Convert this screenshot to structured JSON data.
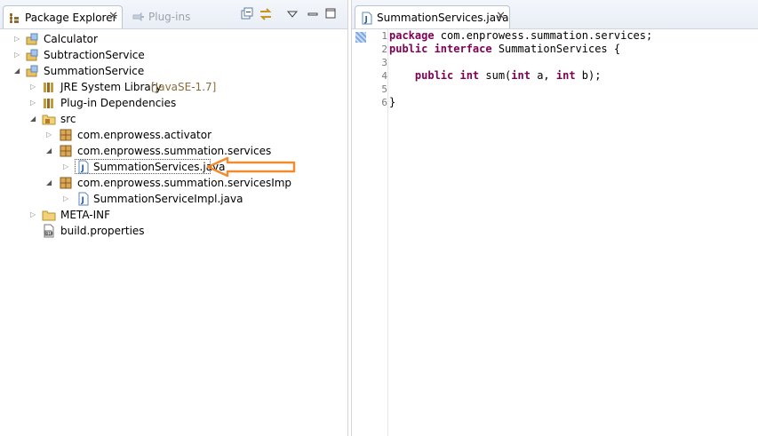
{
  "left_panel": {
    "tabs": [
      {
        "label": "Package Explorer",
        "active": true
      },
      {
        "label": "Plug-ins",
        "active": false
      }
    ],
    "toolbar_icons": [
      "collapse-all-icon",
      "link-with-editor-icon",
      "view-menu-icon",
      "minimize-icon",
      "maximize-icon"
    ]
  },
  "tree": [
    {
      "label": "Calculator",
      "icon": "plugin-project-icon",
      "level": 0,
      "expanded": false
    },
    {
      "label": "SubtractionService",
      "icon": "plugin-project-icon",
      "level": 0,
      "expanded": false
    },
    {
      "label": "SummationService",
      "icon": "plugin-project-icon",
      "level": 0,
      "expanded": true
    },
    {
      "label": "JRE System Library",
      "decoration": "[JavaSE-1.7]",
      "icon": "library-icon",
      "level": 1,
      "expanded": false
    },
    {
      "label": "Plug-in Dependencies",
      "icon": "library-icon",
      "level": 1,
      "expanded": false
    },
    {
      "label": "src",
      "icon": "source-folder-icon",
      "level": 1,
      "expanded": true
    },
    {
      "label": "com.enprowess.activator",
      "icon": "package-icon",
      "level": 2,
      "expanded": false
    },
    {
      "label": "com.enprowess.summation.services",
      "icon": "package-icon",
      "level": 2,
      "expanded": true
    },
    {
      "label": "SummationServices.java",
      "icon": "java-file-icon",
      "level": 3,
      "expanded": false,
      "selected": true
    },
    {
      "label": "com.enprowess.summation.servicesImp",
      "icon": "package-icon",
      "level": 2,
      "expanded": true
    },
    {
      "label": "SummationServiceImpl.java",
      "icon": "java-file-icon",
      "level": 3,
      "expanded": false
    },
    {
      "label": "META-INF",
      "icon": "folder-icon",
      "level": 1,
      "expanded": false
    },
    {
      "label": "build.properties",
      "icon": "properties-file-icon",
      "level": 1,
      "leaf": true
    }
  ],
  "editor": {
    "tab_label": "SummationServices.java",
    "line_numbers": [
      "1",
      "2",
      "3",
      "4",
      "5",
      "6"
    ],
    "code": [
      {
        "kw": "package",
        "rest": " com.enprowess.summation.services;"
      },
      {
        "kw": "public interface",
        "rest": " SummationServices {"
      },
      {
        "kw": "",
        "rest": ""
      },
      {
        "kw": "    public int",
        "rest": " sum(",
        "kw2": "int",
        "rest2": " a, ",
        "kw3": "int",
        "rest3": " b);"
      },
      {
        "kw": "",
        "rest": ""
      },
      {
        "kw": "",
        "rest": "}"
      }
    ]
  },
  "colors": {
    "keyword": "#7f0055",
    "callout_arrow": "#f28a2e",
    "header_bg": "#e9eef6"
  }
}
